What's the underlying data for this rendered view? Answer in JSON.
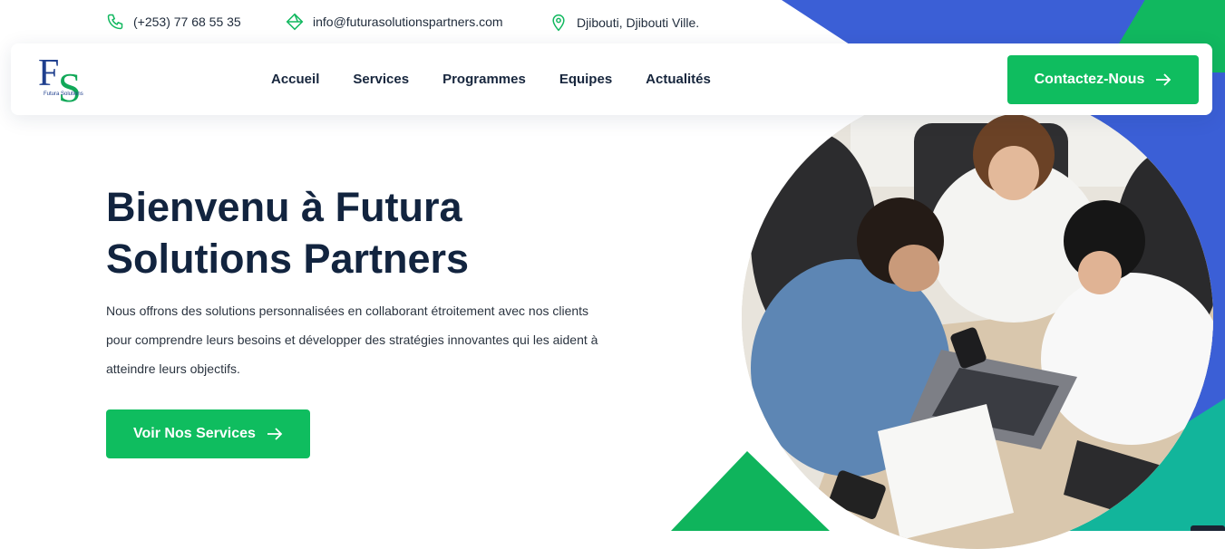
{
  "topbar": {
    "phone": "(+253) 77 68 55 35",
    "email": "info@futurasolutionspartners.com",
    "location": "Djibouti, Djibouti Ville."
  },
  "header": {
    "logo": {
      "letter_1": "F",
      "letter_2": "S",
      "tagline": "Futura Solutions"
    },
    "nav": [
      {
        "label": "Accueil"
      },
      {
        "label": "Services"
      },
      {
        "label": "Programmes"
      },
      {
        "label": "Equipes"
      },
      {
        "label": "Actualités"
      }
    ],
    "cta_label": "Contactez-Nous"
  },
  "hero": {
    "title": "Bienvenu à Futura Solutions Partners",
    "description": "Nous offrons des solutions personnalisées en collaborant étroitement avec nos clients pour comprendre leurs besoins et développer des stratégies innovantes qui les aident à atteindre leurs objectifs.",
    "cta_label": "Voir Nos Services"
  },
  "colors": {
    "accent_green": "#0fbd5f",
    "accent_blue": "#3b5fd6",
    "heading": "#12243f"
  },
  "icons": {
    "phone": "phone-icon",
    "email": "email-icon",
    "location": "location-pin-icon",
    "arrow": "arrow-right-icon"
  }
}
